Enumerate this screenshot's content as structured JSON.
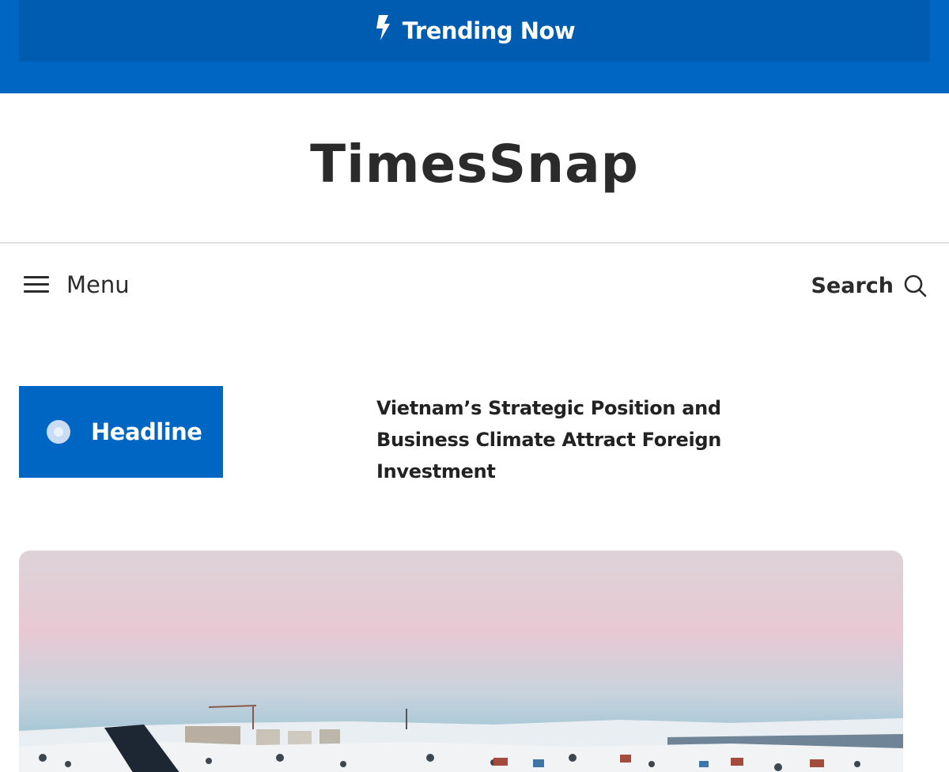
{
  "topbar": {
    "trending_label": "Trending Now",
    "icon": "bolt-icon",
    "background": "#0066c3",
    "inner_background": "#005cb1"
  },
  "brand": {
    "title": "TimesSnap"
  },
  "nav": {
    "menu_label": "Menu",
    "menu_icon": "hamburger-icon",
    "search_label": "Search",
    "search_icon": "search-icon"
  },
  "ticker": {
    "badge_label": "Headline",
    "badge_color": "#0066c3",
    "headline": "Vietnam’s Strategic Position and Business Climate Attract Foreign Investment"
  },
  "featured": {
    "image": "featured-photo-snowy-town-airport"
  }
}
